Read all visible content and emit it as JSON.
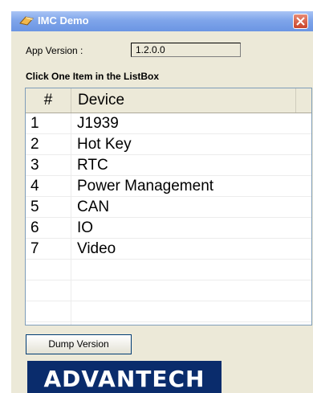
{
  "window": {
    "title": "IMC Demo",
    "title_icon": "app-icon",
    "close_icon": "close-icon",
    "colors": {
      "titlebar": "#7fa5ea",
      "face": "#ece9d8",
      "close": "#c9442a",
      "logo_bg": "#0a2c6c"
    }
  },
  "app_version": {
    "label": "App Version :",
    "value": "1.2.0.0"
  },
  "instruction": "Click One Item in the ListBox",
  "listbox": {
    "columns": [
      "#",
      "Device"
    ],
    "rows": [
      {
        "num": "1",
        "device": "J1939"
      },
      {
        "num": "2",
        "device": "Hot Key"
      },
      {
        "num": "3",
        "device": "RTC"
      },
      {
        "num": "4",
        "device": "Power Management"
      },
      {
        "num": "5",
        "device": "CAN"
      },
      {
        "num": "6",
        "device": "IO"
      },
      {
        "num": "7",
        "device": "Video"
      }
    ]
  },
  "dump_button": "Dump Version",
  "logo": "ADVANTECH"
}
